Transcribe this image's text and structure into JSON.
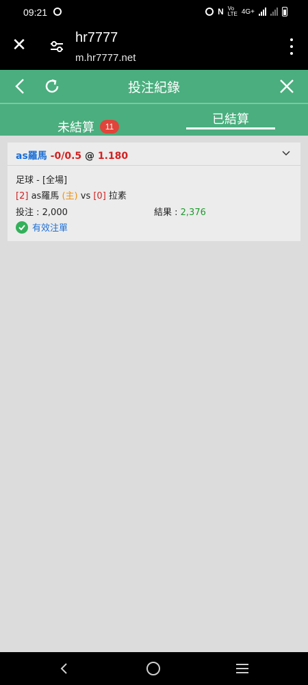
{
  "status_bar": {
    "time": "09:21",
    "network": "4G+",
    "icons": [
      "alarm-icon",
      "nfc-icon",
      "volte-icon",
      "signal-icon",
      "battery-icon"
    ]
  },
  "browser": {
    "title": "hr7777",
    "url": "m.hr7777.net"
  },
  "header": {
    "title": "投注紀錄"
  },
  "tabs": {
    "unsettled_label": "未結算",
    "unsettled_count": "11",
    "settled_label": "已結算",
    "active": "settled"
  },
  "bet": {
    "team": "as羅馬",
    "handicap": "-0/0.5",
    "at": "@",
    "odds": "1.180",
    "sport": "足球 - [全場]",
    "home_score": "[2]",
    "home_team": "as羅馬",
    "home_tag": "(主)",
    "vs": "vs",
    "away_score": "[0]",
    "away_team": "拉素",
    "stake_label": "投注 : ",
    "stake_value": "2,000",
    "result_label": "結果 : ",
    "result_value": "2,376",
    "status": "有效注單"
  },
  "colors": {
    "header_green": "#4aae7e",
    "badge_red": "#e0443a",
    "link_blue": "#1c6fd6",
    "handicap_red": "#d42020",
    "result_green": "#1c9b2c"
  }
}
